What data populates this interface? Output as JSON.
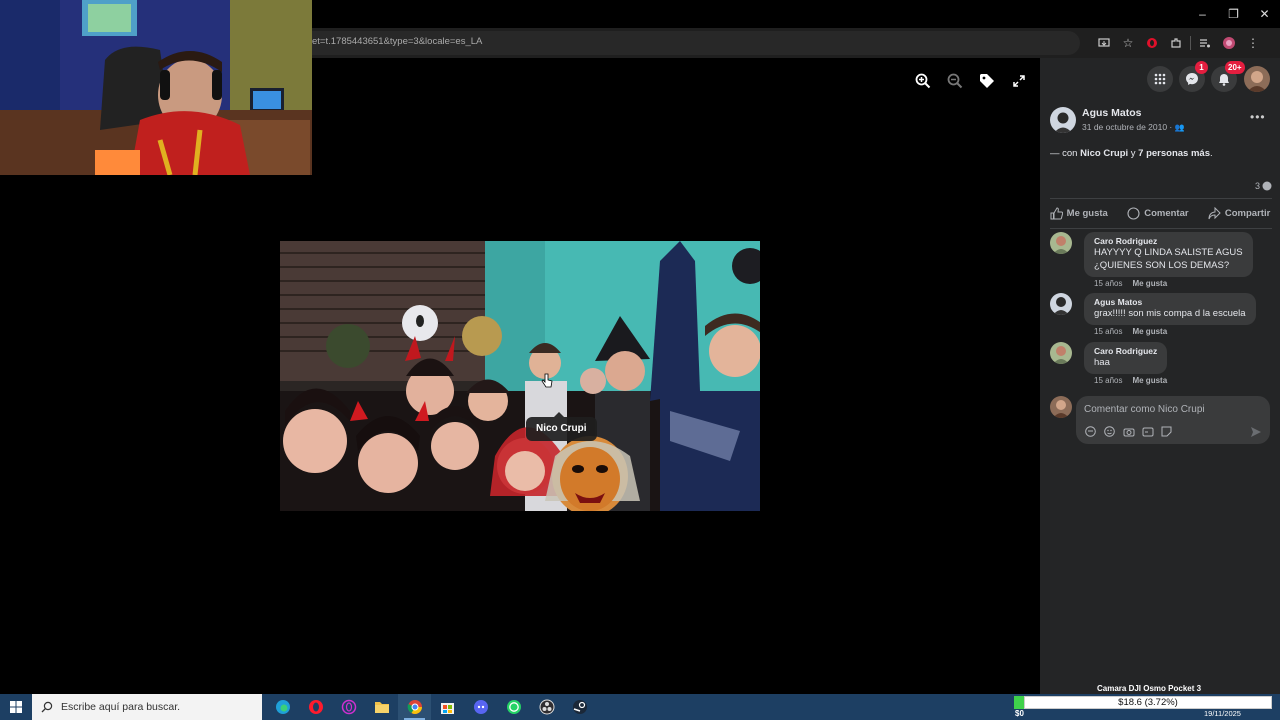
{
  "browser": {
    "url": "et=t.1785443651&type=3&locale=es_LA",
    "window_controls": [
      "minimize-icon",
      "restore-icon",
      "close-icon"
    ],
    "toolbar_icons": [
      "install-icon",
      "star-icon",
      "opera-icon",
      "extensions-icon",
      "media-icon",
      "profile-icon",
      "menu-icon"
    ]
  },
  "viewer": {
    "tools": [
      "zoom-in-icon",
      "zoom-out-icon",
      "tag-icon",
      "fullscreen-icon"
    ],
    "tag_label": "Nico Crupi"
  },
  "header": {
    "messenger_badge": "1",
    "notifications_badge": "20+"
  },
  "post": {
    "author": "Agus Matos",
    "date": "31 de octubre de 2010 ·",
    "with_prefix": "— con ",
    "with_name": "Nico Crupi",
    "with_mid": " y ",
    "with_others": "7 personas más",
    "with_suffix": ".",
    "comment_count": "3",
    "actions": {
      "like": "Me gusta",
      "comment": "Comentar",
      "share": "Compartir"
    }
  },
  "comments": [
    {
      "name": "Caro Rodriguez",
      "lines": [
        "HAYYYY Q LINDA SALISTE AGUS",
        "¿QUIENES SON LOS DEMAS?"
      ],
      "age": "15 años",
      "like": "Me gusta"
    },
    {
      "name": "Agus Matos",
      "lines": [
        "grax!!!!! son mis compa d la escuela"
      ],
      "age": "15 años",
      "like": "Me gusta"
    },
    {
      "name": "Caro Rodriguez",
      "lines": [
        "haa"
      ],
      "age": "15 años",
      "like": "Me gusta"
    }
  ],
  "composer": {
    "placeholder": "Comentar como Nico Crupi"
  },
  "taskbar": {
    "search_placeholder": "Escribe aquí para buscar.",
    "camera_label": "Camara DJI Osmo Pocket 3",
    "price": "$18.6 (3.72%)",
    "money": "$0",
    "date": "19/11/2025"
  }
}
